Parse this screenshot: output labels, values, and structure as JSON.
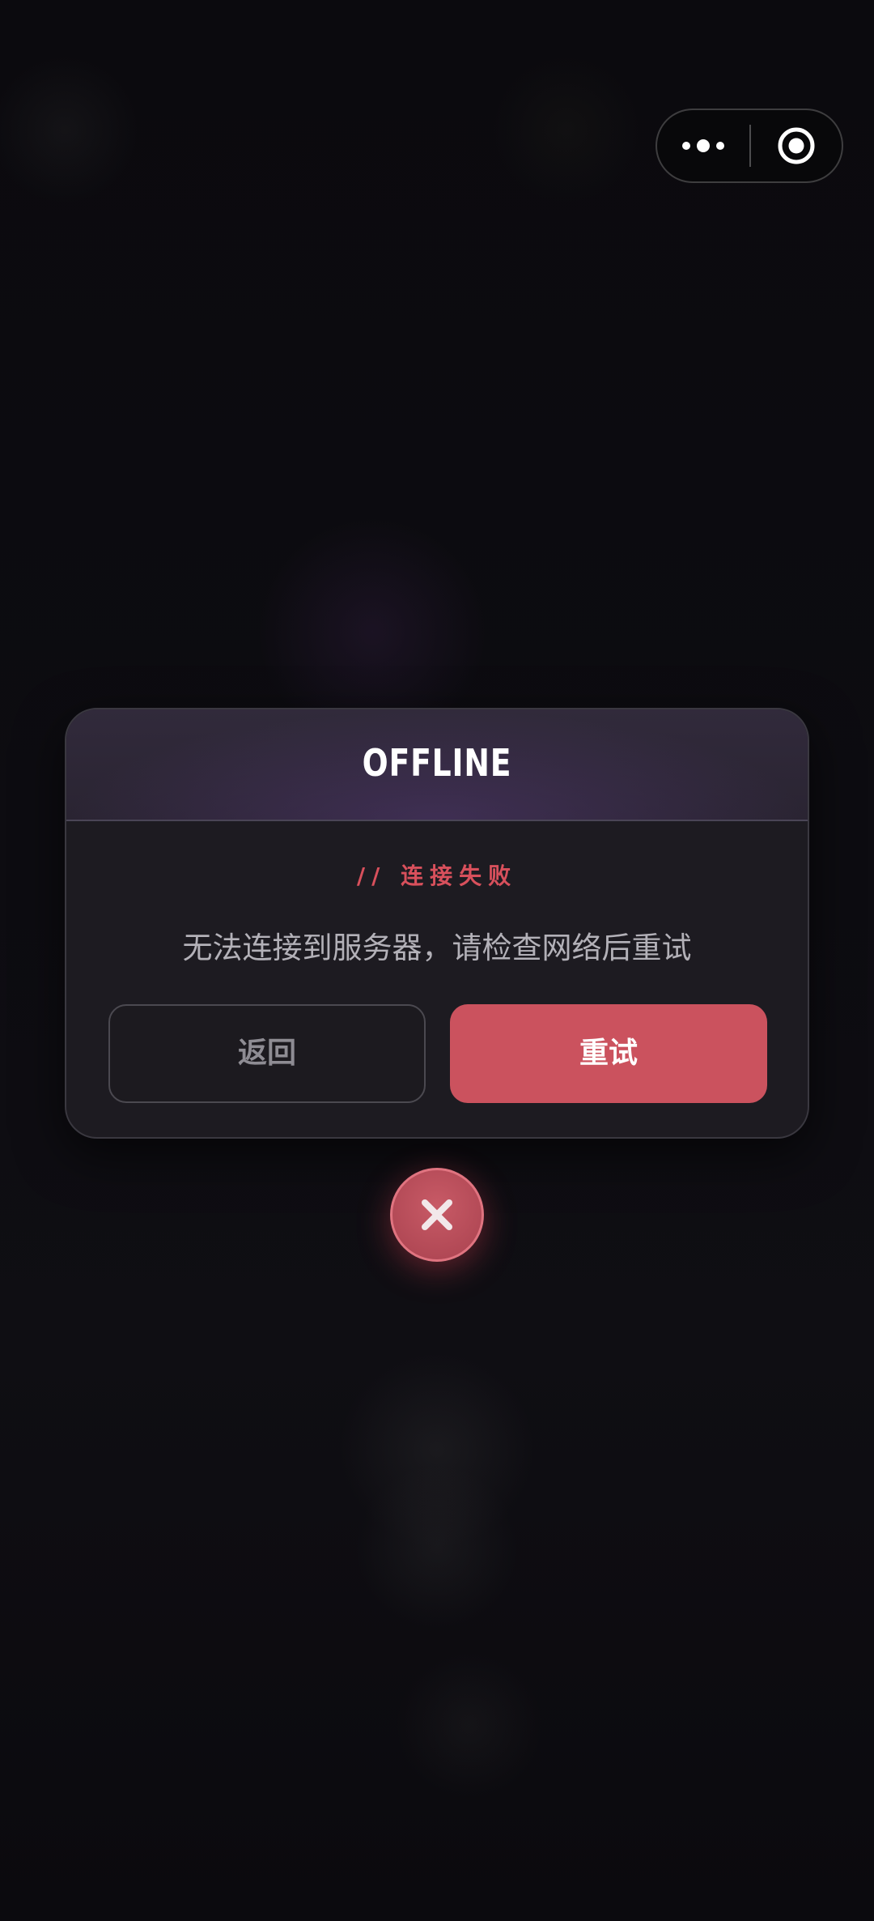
{
  "capsule": {
    "more_icon": "more-dots-icon",
    "close_icon": "target-circle-icon"
  },
  "dialog": {
    "title": "OFFLINE",
    "subtitle": "//  连接失败",
    "message": "无法连接到服务器，请检查网络后重试",
    "back_label": "返回",
    "retry_label": "重试"
  },
  "close_button": {
    "icon": "close-icon"
  },
  "colors": {
    "accent": "#cb525e",
    "subtitle": "#d8505c",
    "background": "#0c0b10",
    "dialog": "#1d1b21"
  }
}
